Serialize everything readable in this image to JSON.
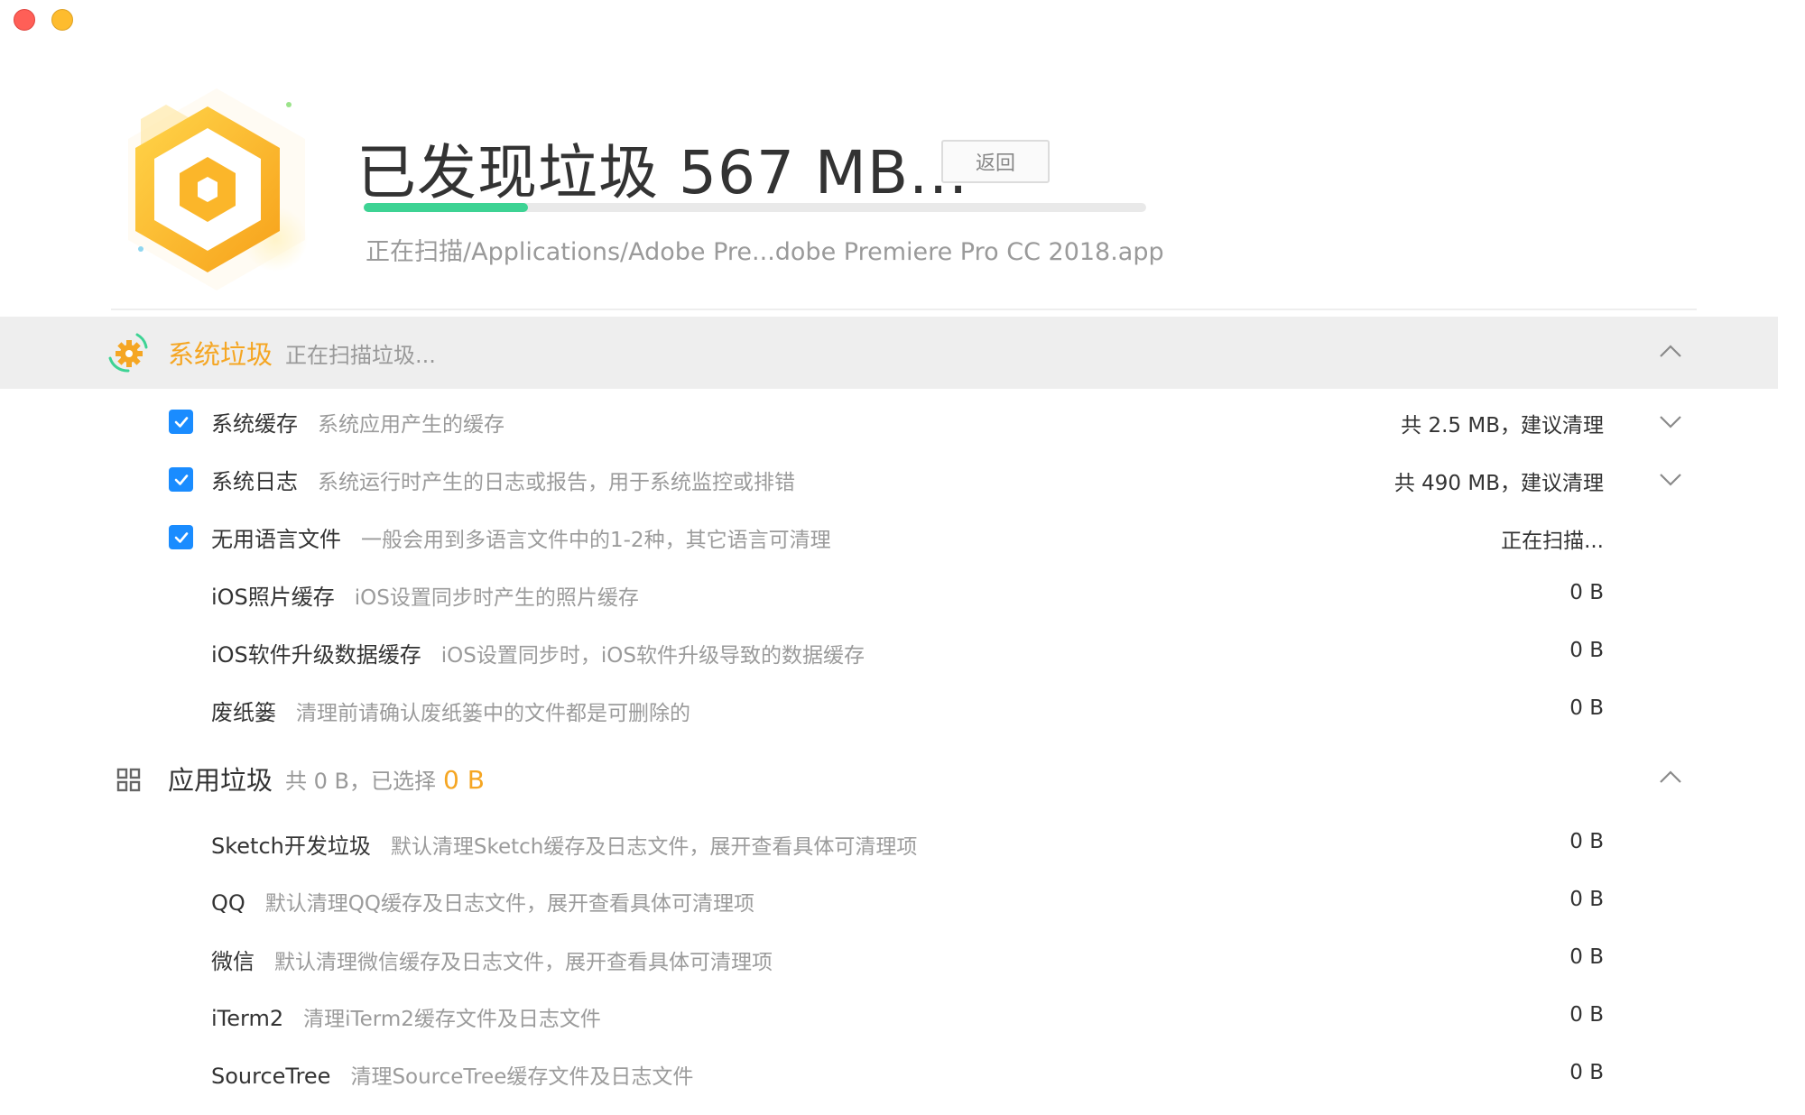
{
  "header": {
    "title": "已发现垃圾 567 MB...",
    "back_label": "返回",
    "progress": 0.21,
    "scan_path": "正在扫描/Applications/Adobe Pre...dobe Premiere Pro CC 2018.app"
  },
  "system_section": {
    "title": "系统垃圾",
    "status": "正在扫描垃圾...",
    "items": [
      {
        "name": "系统缓存",
        "desc": "系统应用产生的缓存",
        "value": "共 2.5 MB，建议清理",
        "checked": true,
        "expandable": true
      },
      {
        "name": "系统日志",
        "desc": "系统运行时产生的日志或报告，用于系统监控或排错",
        "value": "共 490 MB，建议清理",
        "checked": true,
        "expandable": true
      },
      {
        "name": "无用语言文件",
        "desc": "一般会用到多语言文件中的1-2种，其它语言可清理",
        "value": "正在扫描...",
        "checked": true,
        "expandable": false
      },
      {
        "name": "iOS照片缓存",
        "desc": "iOS设置同步时产生的照片缓存",
        "value": "0 B",
        "checked": false,
        "expandable": false
      },
      {
        "name": "iOS软件升级数据缓存",
        "desc": "iOS设置同步时，iOS软件升级导致的数据缓存",
        "value": "0 B",
        "checked": false,
        "expandable": false
      },
      {
        "name": "废纸篓",
        "desc": "清理前请确认废纸篓中的文件都是可删除的",
        "value": "0 B",
        "checked": false,
        "expandable": false
      }
    ]
  },
  "app_section": {
    "title": "应用垃圾",
    "summary_prefix": "共 0 B，已选择",
    "selected_value": "0 B",
    "items": [
      {
        "name": "Sketch开发垃圾",
        "desc": "默认清理Sketch缓存及日志文件，展开查看具体可清理项",
        "value": "0 B"
      },
      {
        "name": "QQ",
        "desc": "默认清理QQ缓存及日志文件，展开查看具体可清理项",
        "value": "0 B"
      },
      {
        "name": "微信",
        "desc": "默认清理微信缓存及日志文件，展开查看具体可清理项",
        "value": "0 B"
      },
      {
        "name": "iTerm2",
        "desc": "清理iTerm2缓存文件及日志文件",
        "value": "0 B"
      },
      {
        "name": "SourceTree",
        "desc": "清理SourceTree缓存文件及日志文件",
        "value": "0 B"
      }
    ]
  },
  "colors": {
    "accent_orange": "#f5a623",
    "progress_green": "#3dd394",
    "checkbox_blue": "#1a8cff"
  },
  "icons": {
    "logo": "hexagon-logo-icon",
    "system_section": "gear-spinner-icon",
    "app_section": "apps-grid-icon",
    "collapse": "chevron-up-icon",
    "expand": "chevron-down-icon",
    "check": "check-icon"
  }
}
